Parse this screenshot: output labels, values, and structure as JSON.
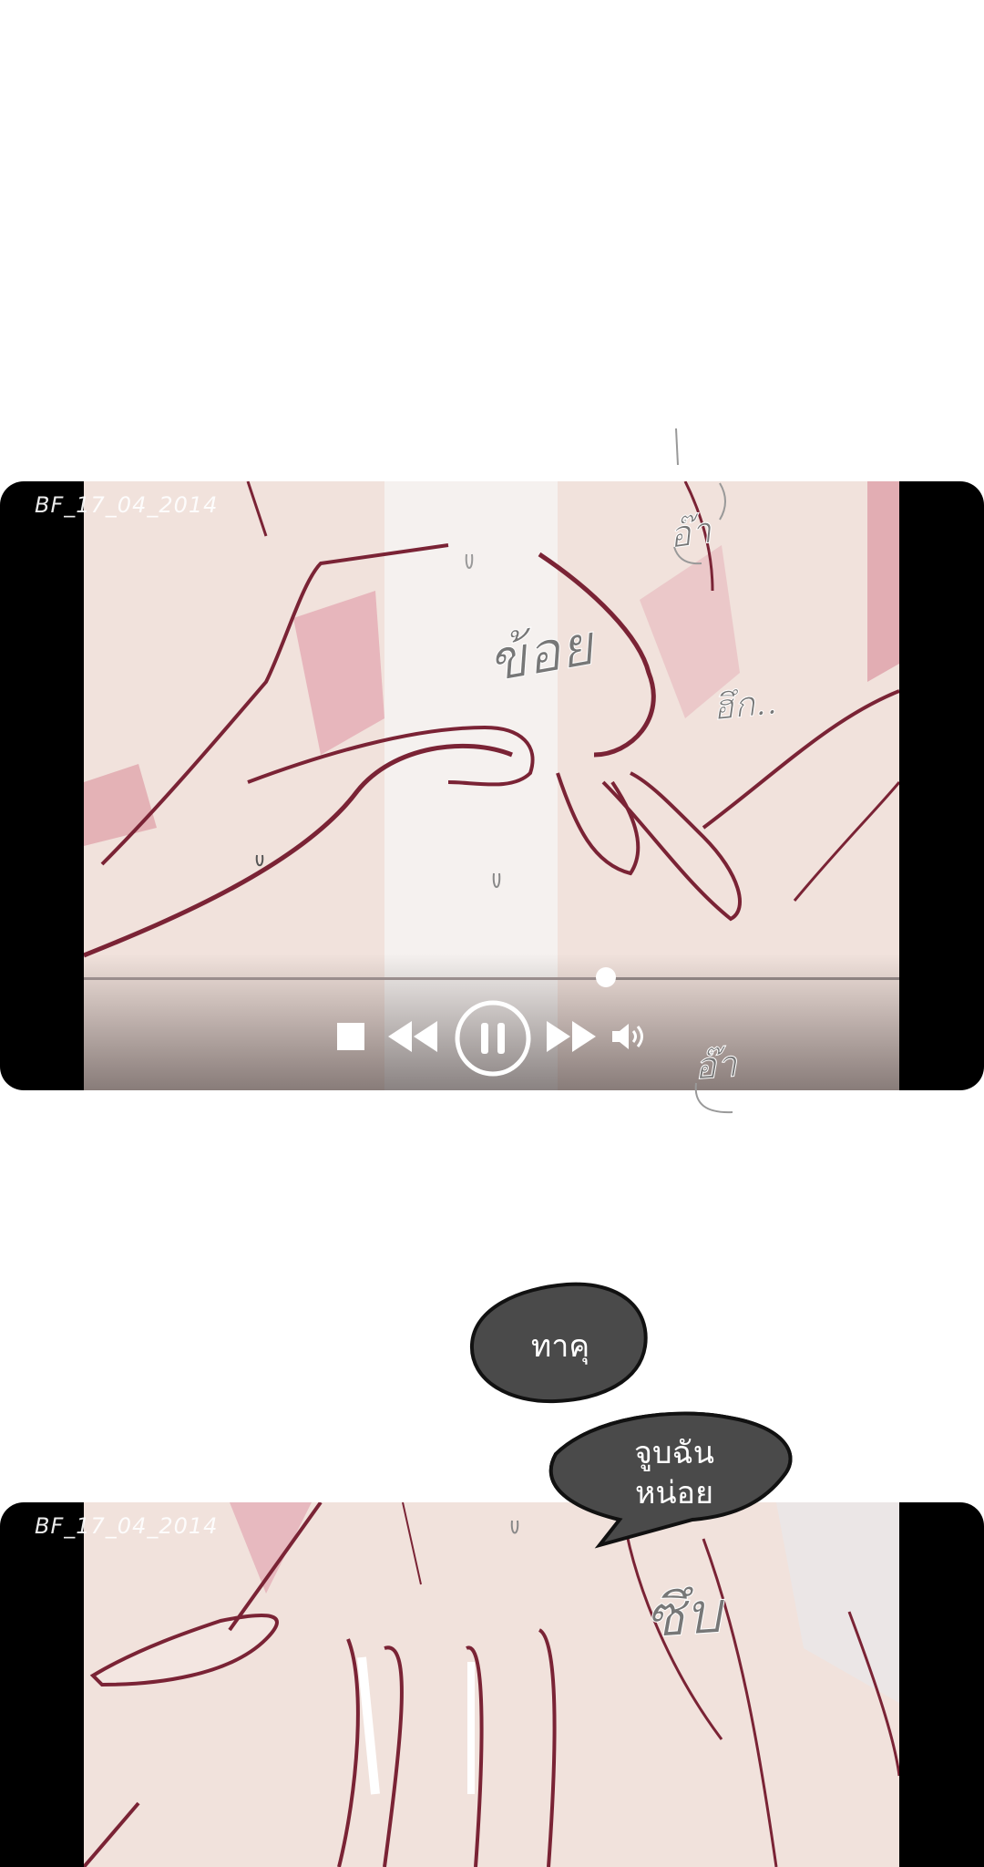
{
  "panels": [
    {
      "timestamp": "BF_17_04_2014",
      "sfx": [
        "ข้อย",
        "อ๊า",
        "ฮึก..",
        "อ๊า"
      ],
      "player": {
        "progress": 0.64,
        "icons": [
          "stop-icon",
          "rewind-icon",
          "pause-icon",
          "fast-forward-icon",
          "volume-icon"
        ]
      }
    },
    {
      "timestamp": "BF_17_04_2014",
      "sfx": [
        "ซึบ"
      ]
    }
  ],
  "dialogue": [
    {
      "text": "ทาคุ"
    },
    {
      "line1": "จูบฉัน",
      "line2": "หน่อย"
    }
  ],
  "colors": {
    "skin": "#f1e2dc",
    "lineart": "#7a2335",
    "shadow": "#d98a98",
    "bubble": "#4a4a4a",
    "letterbox": "#000000"
  }
}
